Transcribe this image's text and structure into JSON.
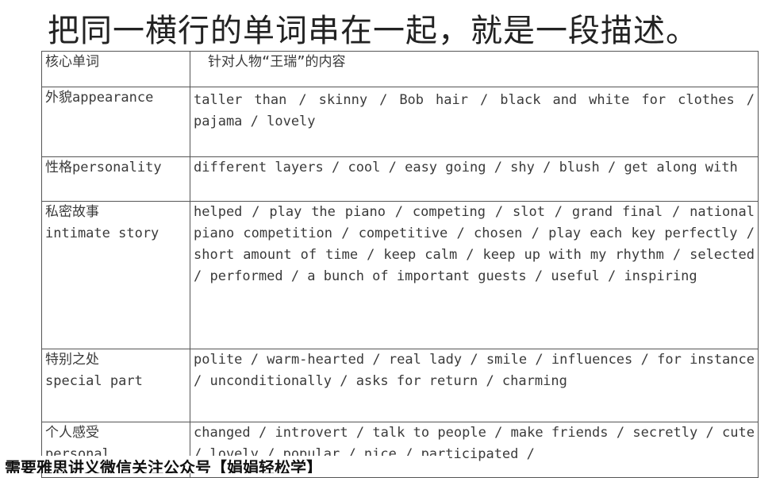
{
  "title": "把同一横行的单词串在一起，就是一段描述。",
  "table": {
    "header": {
      "col1": "核心单词",
      "col2": "针对人物“王瑞”的内容"
    },
    "rows": [
      {
        "label_lines": [
          "外貌appearance"
        ],
        "content": "taller than / skinny / Bob hair / black and white for clothes / pajama / lovely"
      },
      {
        "label_lines": [
          "性格personality"
        ],
        "content": "different layers / cool / easy going / shy / blush / get along with"
      },
      {
        "label_lines": [
          "私密故事",
          "intimate story"
        ],
        "content": "helped / play the piano / competing / slot / grand final / national piano competition / competitive / chosen / play each key perfectly / short amount of time / keep calm / keep up with my rhythm / selected / performed / a bunch of important guests / useful / inspiring"
      },
      {
        "label_lines": [
          "特别之处",
          "special part"
        ],
        "content": "polite / warm-hearted / real lady / smile / influences / for instance / unconditionally / asks for return / charming"
      },
      {
        "label_lines": [
          "个人感受",
          "personal"
        ],
        "content": "changed / introvert / talk to people / make friends / secretly / cute / lovely / popular / nice / participated /"
      }
    ]
  },
  "footer_banner": "需要雅思讲义微信关注公众号【娟娟轻松学】"
}
